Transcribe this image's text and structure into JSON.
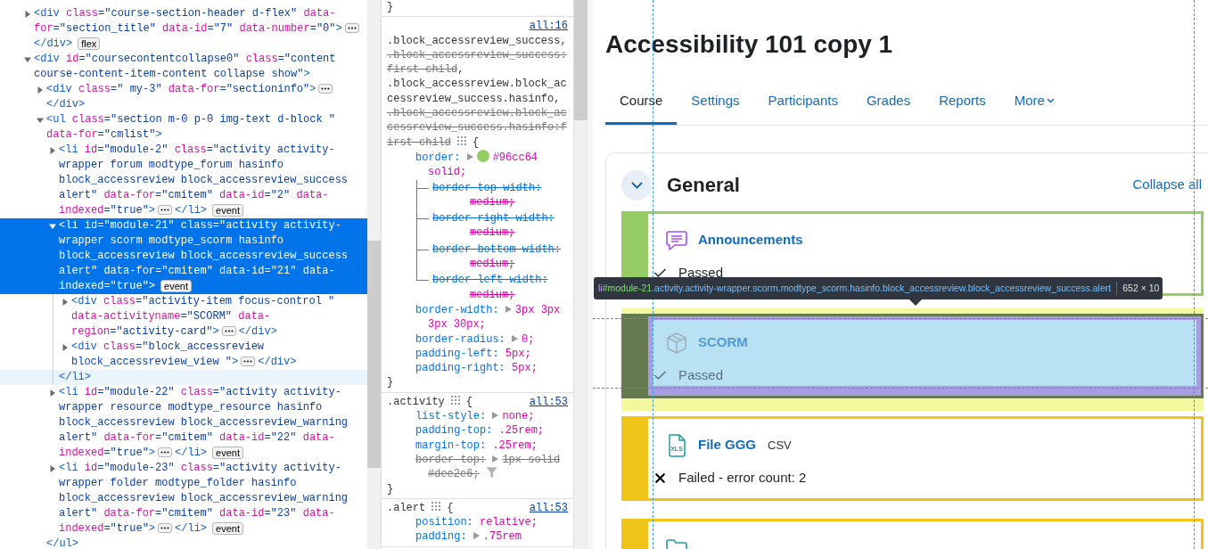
{
  "dom_tree": [
    {
      "tag": "<div",
      "attrs": [
        {
          "name": "class",
          "value": "=\"course-section-header d-flex\""
        },
        {
          "name": "data-for",
          "value": "=\"section_title\""
        },
        {
          "name": "data-id",
          "value": "=\"7\""
        },
        {
          "name": "data-number",
          "value": "=\"0\""
        }
      ],
      "end": ">",
      "close": "</div>",
      "badge": "flex",
      "expanded": false,
      "selected": false
    },
    {
      "tag": "<div",
      "attrs": [
        {
          "name": "id",
          "value": "=\"coursecontentcollapse0\""
        },
        {
          "name": "class",
          "value": "=\"content course-content-item-content collapse show\""
        }
      ],
      "end": ">",
      "expanded": true,
      "selected": false,
      "children": [
        {
          "tag": "<div",
          "attrs": [
            {
              "name": "class",
              "value": "=\" my-3\""
            },
            {
              "name": "data-for",
              "value": "=\"sectioninfo\""
            }
          ],
          "end": ">",
          "close": "</div>",
          "expanded": false,
          "selected": false
        },
        {
          "tag": "<ul",
          "attrs": [
            {
              "name": "class",
              "value": "=\"section m-0 p-0 img-text d-block \""
            },
            {
              "name": "data-for",
              "value": "=\"cmlist\""
            }
          ],
          "end": ">",
          "close": "</ul>",
          "expanded": true,
          "selected": false,
          "close_hovered": false,
          "children": [
            {
              "tag": "<li",
              "attrs": [
                {
                  "name": "id",
                  "value": "=\"module-2\""
                },
                {
                  "name": "class",
                  "value": "=\"activity activity-wrapper forum modtype_forum hasinfo block_accessreview block_accessreview_success alert\""
                },
                {
                  "name": "data-for",
                  "value": "=\"cmitem\""
                },
                {
                  "name": "data-id",
                  "value": "=\"2\""
                },
                {
                  "name": "data-indexed",
                  "value": "=\"true\""
                }
              ],
              "end": ">",
              "close": "</li>",
              "badge": "event",
              "expanded": false,
              "selected": false
            },
            {
              "tag": "<li",
              "attrs": [
                {
                  "name": "id",
                  "value": "=\"module-21\""
                },
                {
                  "name": "class",
                  "value": "=\"activity activity-wrapper scorm modtype_scorm hasinfo block_accessreview block_accessreview_success alert\""
                },
                {
                  "name": "data-for",
                  "value": "=\"cmitem\""
                },
                {
                  "name": "data-id",
                  "value": "=\"21\""
                },
                {
                  "name": "data-indexed",
                  "value": "=\"true\""
                }
              ],
              "end": ">",
              "close": "</li>",
              "badge": "event",
              "expanded": true,
              "selected": true,
              "close_hovered": true,
              "children": [
                {
                  "tag": "<div",
                  "attrs": [
                    {
                      "name": "class",
                      "value": "=\"activity-item focus-control \""
                    },
                    {
                      "name": "data-activityname",
                      "value": "=\"SCORM\""
                    },
                    {
                      "name": "data-region",
                      "value": "=\"activity-card\""
                    }
                  ],
                  "end": ">",
                  "close": "</div>",
                  "expanded": false,
                  "selected": false
                },
                {
                  "tag": "<div",
                  "attrs": [
                    {
                      "name": "class",
                      "value": "=\"block_accessreview block_accessreview_view \""
                    }
                  ],
                  "end": ">",
                  "close": "</div>",
                  "expanded": false,
                  "selected": false
                }
              ]
            },
            {
              "tag": "<li",
              "attrs": [
                {
                  "name": "id",
                  "value": "=\"module-22\""
                },
                {
                  "name": "class",
                  "value": "=\"activity activity-wrapper resource modtype_resource hasinfo block_accessreview block_accessreview_warning alert\""
                },
                {
                  "name": "data-for",
                  "value": "=\"cmitem\""
                },
                {
                  "name": "data-id",
                  "value": "=\"22\""
                },
                {
                  "name": "data-indexed",
                  "value": "=\"true\""
                }
              ],
              "end": ">",
              "close": "</li>",
              "badge": "event",
              "expanded": false,
              "selected": false
            },
            {
              "tag": "<li",
              "attrs": [
                {
                  "name": "id",
                  "value": "=\"module-23\""
                },
                {
                  "name": "class",
                  "value": "=\"activity activity-wrapper folder modtype_folder hasinfo block_accessreview block_accessreview_warning alert\""
                },
                {
                  "name": "data-for",
                  "value": "=\"cmitem\""
                },
                {
                  "name": "data-id",
                  "value": "=\"23\""
                },
                {
                  "name": "data-indexed",
                  "value": "=\"true\""
                }
              ],
              "end": ">",
              "close": "</li>",
              "badge": "event",
              "expanded": false,
              "selected": false
            }
          ]
        }
      ]
    }
  ],
  "styles": {
    "rules": [
      {
        "close": "}"
      },
      {
        "source": "all:16",
        "selectors": [
          {
            "text": ".block_accessreview_success",
            "matched": true,
            "sep": ","
          },
          {
            "text": ".block_accessreview_success:first-child",
            "matched": false,
            "sep": ","
          },
          {
            "text": ".block_accessreview.block_accessreview_success.hasinfo",
            "matched": true,
            "sep": ","
          },
          {
            "text": ".block_accessreview.block_accessreview_success.hasinfo:first-child",
            "matched": false
          }
        ],
        "open": "{",
        "properties": [
          {
            "name": "border:",
            "value": "#96cc64 solid;",
            "expander": true,
            "swatch": true,
            "overridden": false,
            "children": [
              {
                "name": "border-top-width:",
                "value": "medium;",
                "overridden": true
              },
              {
                "name": "border-right-width:",
                "value": "medium;",
                "overridden": true
              },
              {
                "name": "border-bottom-width:",
                "value": "medium;",
                "overridden": true
              },
              {
                "name": "border-left-width:",
                "value": "medium;",
                "overridden": true
              }
            ]
          },
          {
            "name": "border-width:",
            "value": "3px 3px 3px 30px;",
            "expander": true,
            "overridden": false
          },
          {
            "name": "border-radius:",
            "value": "0;",
            "expander": true,
            "overridden": false
          },
          {
            "name": "padding-left:",
            "value": "5px;",
            "expander": false,
            "overridden": false
          },
          {
            "name": "padding-right:",
            "value": "5px;",
            "expander": false,
            "overridden": false
          }
        ],
        "close": "}"
      },
      {
        "source": "all:53",
        "selectors": [
          {
            "text": ".activity",
            "matched": true
          }
        ],
        "open": "{",
        "properties": [
          {
            "name": "list-style:",
            "value": "none;",
            "expander": true,
            "overridden": false
          },
          {
            "name": "padding-top:",
            "value": ".25rem;",
            "expander": false,
            "overridden": false
          },
          {
            "name": "margin-top:",
            "value": ".25rem;",
            "expander": false,
            "overridden": false
          },
          {
            "name": "border-top:",
            "value": "1px solid #dee2e6;",
            "expander": true,
            "overridden": true,
            "filter": true
          }
        ],
        "close": "}"
      },
      {
        "source": "all:53",
        "selectors": [
          {
            "text": ".alert",
            "matched": true
          }
        ],
        "open": "{",
        "properties": [
          {
            "name": "position:",
            "value": "relative;",
            "expander": false,
            "overridden": false
          },
          {
            "name": "padding:",
            "value": ".75rem",
            "expander": true,
            "overridden": false
          }
        ]
      }
    ]
  },
  "page": {
    "title": "Accessibility 101 copy 1",
    "tabs": [
      {
        "label": "Course",
        "selected": true
      },
      {
        "label": "Settings",
        "selected": false
      },
      {
        "label": "Participants",
        "selected": false
      },
      {
        "label": "Grades",
        "selected": false
      },
      {
        "label": "Reports",
        "selected": false
      },
      {
        "label": "More",
        "selected": false,
        "kind": "menu"
      }
    ],
    "section": {
      "title": "General",
      "expanded": true,
      "collapse_all": "Collapse all",
      "activities": [
        {
          "kind": "forum",
          "name": "Announcements",
          "color": "#96cc64",
          "highlighted": false,
          "status": {
            "kind": "passed",
            "text": "Passed"
          }
        },
        {
          "kind": "scorm",
          "name": "SCORM",
          "highlighted": true,
          "status": {
            "kind": "passed",
            "text": "Passed"
          }
        },
        {
          "kind": "spreadsheet",
          "icon_label": "XLS",
          "name": "File GGG",
          "type_label": "CSV",
          "color": "#f0c419",
          "highlighted": false,
          "status": {
            "kind": "failed",
            "text": "Failed - error count: 2"
          }
        },
        {
          "kind": "folder",
          "color": "#f0c419",
          "highlighted": false
        }
      ]
    },
    "tooltip": {
      "tag": "li",
      "id": "#module-21",
      "classes": ".activity.activity-wrapper.scorm.modtype_scorm.hasinfo.block_accessreview.block_accessreview_success.alert",
      "size": "652 × 10"
    }
  }
}
